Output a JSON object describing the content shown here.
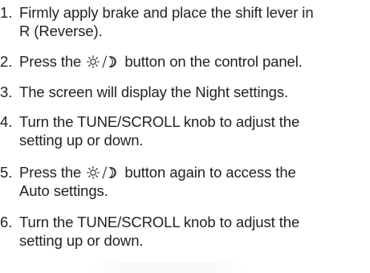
{
  "steps": [
    {
      "number": "1.",
      "lines": [
        "Firmly apply brake and place the shift lever in",
        "R (Reverse)."
      ]
    },
    {
      "number": "2.",
      "before_icon": "Press the",
      "icon": "day-night-icon",
      "after_icon": "button on the control panel."
    },
    {
      "number": "3.",
      "lines": [
        "The screen will display the Night settings."
      ]
    },
    {
      "number": "4.",
      "lines": [
        "Turn the TUNE/SCROLL knob to adjust the",
        "setting up or down."
      ]
    },
    {
      "number": "5.",
      "before_icon": "Press the",
      "icon": "day-night-icon",
      "after_icon": "button again to access the",
      "second_line": "Auto settings."
    },
    {
      "number": "6.",
      "lines": [
        "Turn the TUNE/SCROLL knob to adjust the",
        "setting up or down."
      ]
    }
  ]
}
